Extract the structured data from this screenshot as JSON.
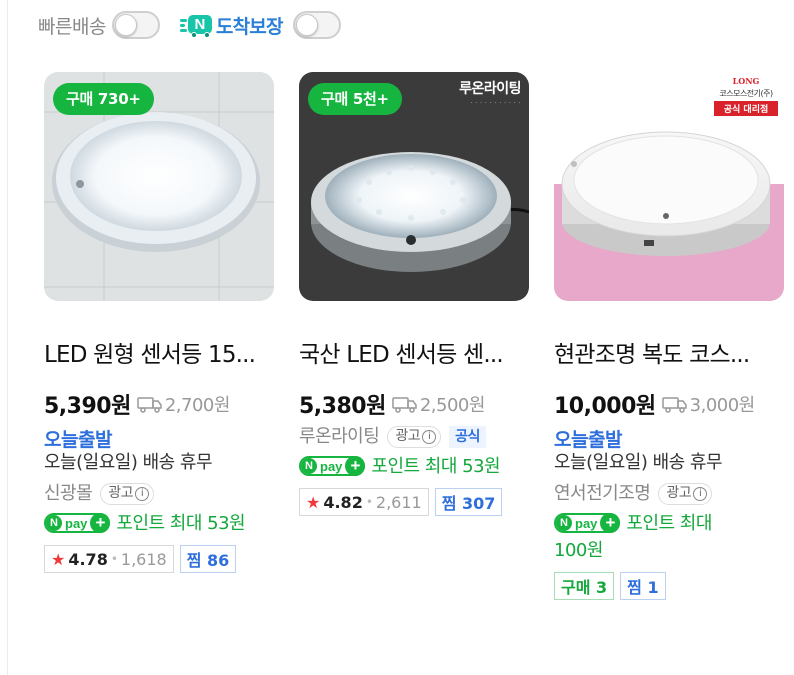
{
  "filters": {
    "fast_delivery_label": "빠른배송",
    "arrival_badge_letter": "N",
    "arrival_guarantee_label": "도착보장"
  },
  "npay": {
    "n": "N",
    "pay": "pay",
    "plus": "+"
  },
  "products": [
    {
      "badge": "구매 730+",
      "title": "LED 원형 센서등 15...",
      "price": "5,390원",
      "shipping": "2,700원",
      "today_label": "오늘출발",
      "delivery_note": "오늘(일요일) 배송 휴무",
      "seller": "신광몰",
      "ad_label": "광고",
      "points": "포인트 최대 53원",
      "rating": "4.78",
      "reviews": "1,618",
      "zzim": "찜 86"
    },
    {
      "badge": "구매 5천+",
      "brand_overlay": "루온라이팅",
      "title": "국산 LED 센서등 센...",
      "price": "5,380원",
      "shipping": "2,500원",
      "seller": "루온라이팅",
      "ad_label": "광고",
      "official_label": "공식",
      "points": "포인트 최대 53원",
      "rating": "4.82",
      "reviews": "2,611",
      "zzim": "찜 307"
    },
    {
      "brand_overlay_top": "LONG",
      "brand_overlay_name": "코스모스전기(주)",
      "brand_overlay_tag": "공식 대리점",
      "title": "현관조명 복도 코스...",
      "price": "10,000원",
      "shipping": "3,000원",
      "today_label": "오늘출발",
      "delivery_note": "오늘(일요일) 배송 휴무",
      "seller": "연서전기조명",
      "ad_label": "광고",
      "points_line1": "포인트 최대",
      "points_line2": "100원",
      "buy_count": "구매 3",
      "zzim": "찜 1"
    }
  ],
  "colors": {
    "buy_badge": "#15b53f",
    "npay_green": "#15b53f",
    "today_blue": "#2e6fdc",
    "arrival_teal": "#19c5a8",
    "star_red": "#ee3c3c"
  }
}
